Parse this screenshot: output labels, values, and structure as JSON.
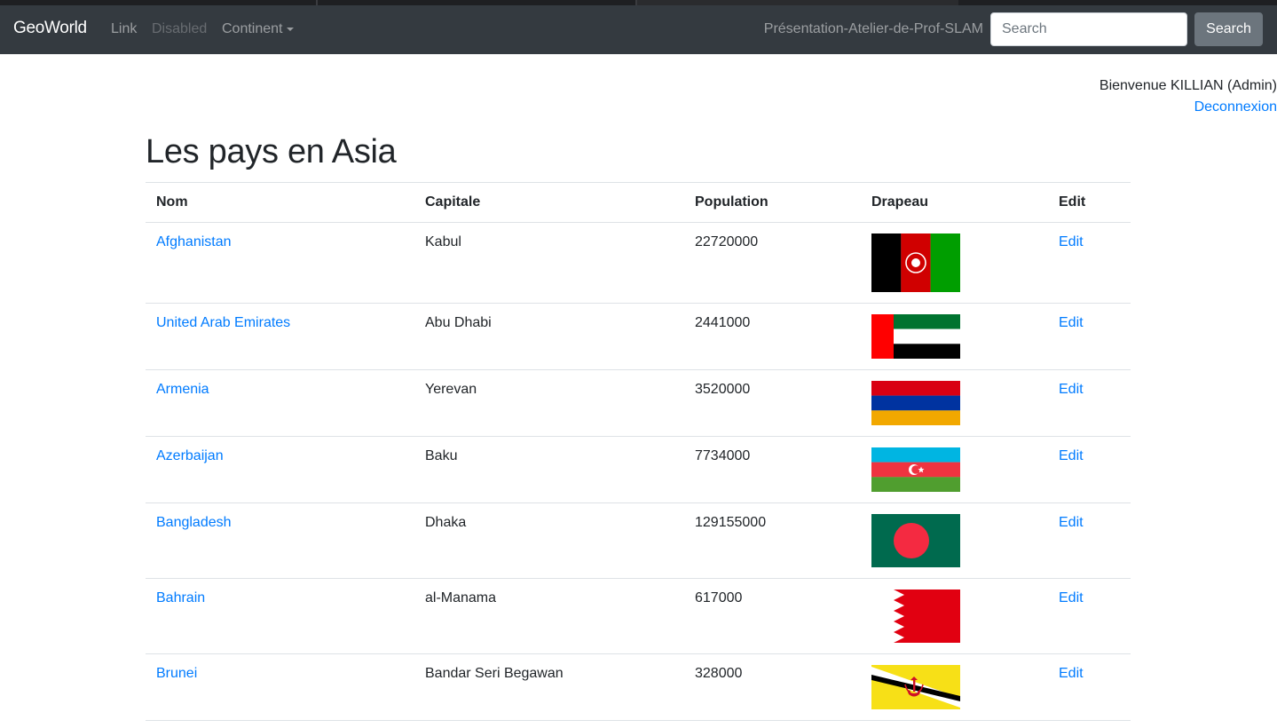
{
  "navbar": {
    "brand": "GeoWorld",
    "link": "Link",
    "disabled": "Disabled",
    "continent": "Continent",
    "project": "Présentation-Atelier-de-Prof-SLAM",
    "search_placeholder": "Search",
    "search_button": "Search"
  },
  "user": {
    "welcome": "Bienvenue KILLIAN (Admin)",
    "logout": "Deconnexion"
  },
  "page": {
    "title": "Les pays en Asia"
  },
  "table": {
    "headers": [
      "Nom",
      "Capitale",
      "Population",
      "Drapeau",
      "Edit"
    ],
    "rows": [
      {
        "name": "Afghanistan",
        "capital": "Kabul",
        "population": "22720000",
        "flag": "afghanistan-flag",
        "edit": "Edit"
      },
      {
        "name": "United Arab Emirates",
        "capital": "Abu Dhabi",
        "population": "2441000",
        "flag": "uae-flag",
        "edit": "Edit"
      },
      {
        "name": "Armenia",
        "capital": "Yerevan",
        "population": "3520000",
        "flag": "armenia-flag",
        "edit": "Edit"
      },
      {
        "name": "Azerbaijan",
        "capital": "Baku",
        "population": "7734000",
        "flag": "azerbaijan-flag",
        "edit": "Edit"
      },
      {
        "name": "Bangladesh",
        "capital": "Dhaka",
        "population": "129155000",
        "flag": "bangladesh-flag",
        "edit": "Edit"
      },
      {
        "name": "Bahrain",
        "capital": "al-Manama",
        "population": "617000",
        "flag": "bahrain-flag",
        "edit": "Edit"
      },
      {
        "name": "Brunei",
        "capital": "Bandar Seri Begawan",
        "population": "328000",
        "flag": "brunei-flag",
        "edit": "Edit"
      }
    ]
  },
  "colors": {
    "navbar_bg": "#343a40",
    "link": "#007bff",
    "button_secondary": "#6c757d"
  }
}
